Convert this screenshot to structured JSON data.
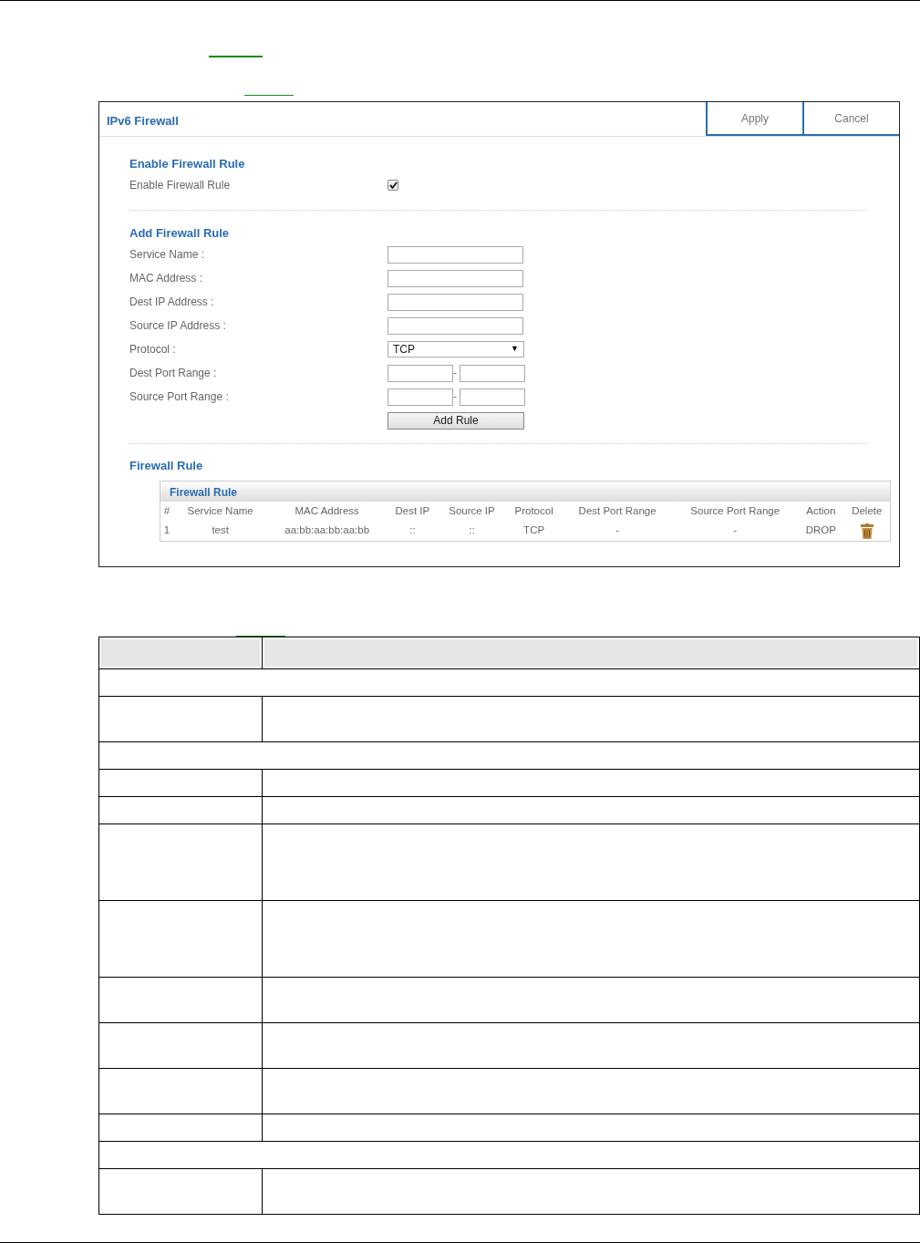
{
  "window": {
    "title": "IPv6 Firewall"
  },
  "header_buttons": [
    {
      "label": "Apply"
    },
    {
      "label": "Cancel"
    }
  ],
  "enable_section": {
    "heading": "Enable Firewall Rule",
    "label": "Enable Firewall Rule",
    "checked": true
  },
  "add_section": {
    "heading": "Add Firewall Rule",
    "fields": [
      {
        "kind": "text",
        "label": "Service Name :"
      },
      {
        "kind": "text",
        "label": "MAC Address :"
      },
      {
        "kind": "text",
        "label": "Dest IP Address :"
      },
      {
        "kind": "text",
        "label": "Source IP Address :"
      },
      {
        "kind": "select",
        "label": "Protocol :",
        "value": "TCP",
        "arrow": "▼"
      },
      {
        "kind": "range",
        "label": "Dest Port Range :",
        "separator": "-"
      },
      {
        "kind": "range",
        "label": "Source Port Range :",
        "separator": "-"
      }
    ],
    "button": "Add Rule"
  },
  "rule_section": {
    "heading": "Firewall Rule",
    "table": {
      "title": "Firewall Rule",
      "columns": [
        "#",
        "Service Name",
        "MAC Address",
        "Dest IP",
        "Source IP",
        "Protocol",
        "Dest Port Range",
        "Source Port Range",
        "Action",
        "Delete"
      ],
      "rows": [
        {
          "cells": [
            "1",
            "test",
            "aa:bb:aa:bb:aa:bb",
            "::",
            "::",
            "TCP",
            "-",
            "-",
            "DROP"
          ]
        }
      ]
    }
  },
  "doc_table": {
    "rows": [
      {
        "kind": "header"
      },
      {
        "kind": "section"
      },
      {
        "kind": "double"
      },
      {
        "kind": "section"
      },
      {
        "kind": "single"
      },
      {
        "kind": "single"
      },
      {
        "kind": "quad"
      },
      {
        "kind": "quad"
      },
      {
        "kind": "double"
      },
      {
        "kind": "double"
      },
      {
        "kind": "double"
      },
      {
        "kind": "single"
      },
      {
        "kind": "section"
      },
      {
        "kind": "double"
      }
    ]
  }
}
